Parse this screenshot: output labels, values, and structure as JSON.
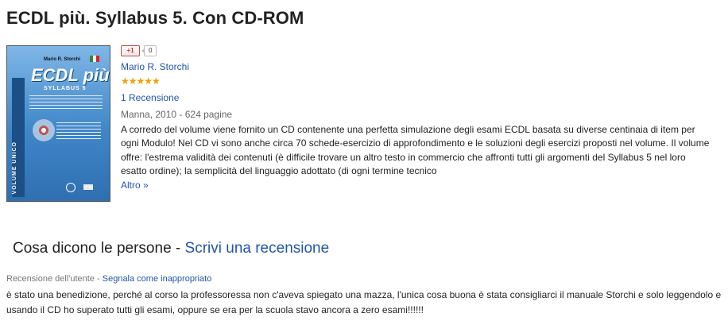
{
  "book": {
    "title": "ECDL più. Syllabus 5. Con CD-ROM",
    "author": "Mario R. Storchi",
    "rating_stars": "★★★★★",
    "rating_value": 5,
    "reviews_link": "1 Recensione",
    "publisher_info": "Manna, 2010 - 624 pagine",
    "description": "A corredo del volume viene fornito un CD contenente una perfetta simulazione degli esami ECDL basata su diverse centinaia di item per ogni Modulo! Nel CD vi sono anche circa 70 schede-esercizio di approfondimento e le soluzioni degli esercizi proposti nel volume. Il volume offre: l'estrema validità dei contenuti (è difficile trovare un altro testo in commercio che affronti tutti gli argomenti del Syllabus 5 nel loro esatto ordine); la semplicità del linguaggio adottato (di ogni termine tecnico",
    "more_link": "Altro »"
  },
  "cover": {
    "author": "Mario R. Storchi",
    "title": "ECDL più",
    "subtitle": "SYLLABUS 5",
    "spine_text": "VOLUME UNICO",
    "colors": {
      "top": "#7fb6e6",
      "bottom": "#2f6fb0"
    }
  },
  "social": {
    "plusone_label": "+1",
    "plusone_count": "0"
  },
  "reviews_section": {
    "heading": "Cosa dicono le persone",
    "separator": " - ",
    "write_review_link": "Scrivi una recensione"
  },
  "user_review": {
    "label": "Recensione dell'utente",
    "separator": " - ",
    "report_link": "Segnala come inappropriato",
    "text": "è stato una benedizione, perché al corso la professoressa non c'aveva spiegato una mazza, l'unica cosa buona è stata consigliarci il manuale Storchi e solo leggendolo e usando il CD ho superato tutti gli esami, oppure se era per la scuola stavo ancora a zero esami!!!!!!"
  },
  "colors": {
    "link": "#2255aa",
    "star": "#f0a000",
    "muted": "#666666"
  }
}
